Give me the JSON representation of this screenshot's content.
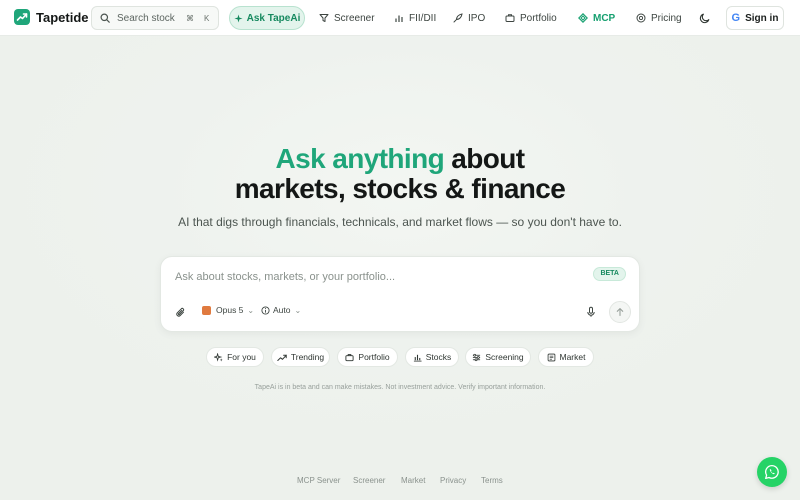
{
  "nav": {
    "brand": "Tapetide",
    "search_placeholder": "Search stock",
    "shortcut_cmd": "⌘",
    "shortcut_key": "K",
    "ask_label": "Ask TapeAi",
    "items": [
      {
        "label": "Screener",
        "icon": "filter-icon"
      },
      {
        "label": "FII/DII",
        "icon": "bar-chart-icon"
      },
      {
        "label": "IPO",
        "icon": "rocket-icon"
      },
      {
        "label": "Portfolio",
        "icon": "briefcase-icon"
      },
      {
        "label": "MCP",
        "icon": "mcp-icon"
      },
      {
        "label": "Pricing",
        "icon": "coin-icon"
      }
    ],
    "theme_icon": "moon-icon",
    "signin_label": "Sign in"
  },
  "hero": {
    "accent": "Ask anything",
    "line1_rest": " about",
    "line2": "markets, stocks & finance",
    "subtitle": "AI that digs through financials, technicals, and market flows — so you don't have to."
  },
  "chat": {
    "placeholder": "Ask about stocks, markets, or your portfolio...",
    "beta": "BETA",
    "model": "Opus 5",
    "mode": "Auto"
  },
  "chips": [
    {
      "label": "For you",
      "icon": "sparkle-icon"
    },
    {
      "label": "Trending",
      "icon": "trending-icon"
    },
    {
      "label": "Portfolio",
      "icon": "briefcase-icon"
    },
    {
      "label": "Stocks",
      "icon": "bar-chart-icon"
    },
    {
      "label": "Screening",
      "icon": "sliders-icon"
    },
    {
      "label": "Market",
      "icon": "newspaper-icon"
    }
  ],
  "disclaimer": "TapeAi is in beta and can make mistakes. Not investment advice. Verify important information.",
  "footer": [
    "MCP Server",
    "Screener",
    "Market",
    "Privacy",
    "Terms"
  ],
  "colors": {
    "accent": "#1fa67a",
    "background": "#edf1ec",
    "whatsapp": "#25d366"
  }
}
